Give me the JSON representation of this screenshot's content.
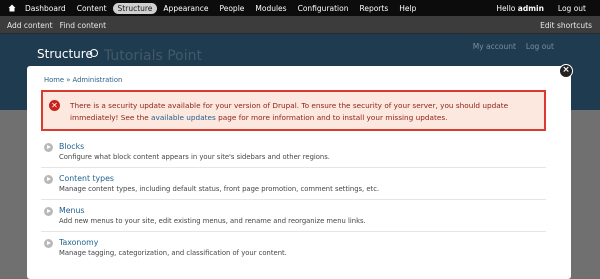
{
  "toolbar": {
    "items": [
      "Dashboard",
      "Content",
      "Structure",
      "Appearance",
      "People",
      "Modules",
      "Configuration",
      "Reports",
      "Help"
    ],
    "user_greeting": "Hello",
    "user_name": "admin",
    "logout": "Log out"
  },
  "shortcuts": {
    "links": [
      "Add content",
      "Find content"
    ],
    "edit": "Edit shortcuts"
  },
  "header": {
    "title": "Structure",
    "site_name": "Tutorials Point",
    "my_account": "My account",
    "logout": "Log out"
  },
  "overlay": {
    "breadcrumb": "Home » Administration",
    "alert": {
      "text_before": "There is a security update available for your version of Drupal. To ensure the security of your server, you should update immediately! See the",
      "link": "available updates",
      "text_after": "page for more information and to install your missing updates."
    },
    "items": [
      {
        "title": "Blocks",
        "description": "Configure what block content appears in your site's sidebars and other regions."
      },
      {
        "title": "Content types",
        "description": "Manage content types, including default status, front page promotion, comment settings, etc."
      },
      {
        "title": "Menus",
        "description": "Add new menus to your site, edit existing menus, and rename and reorganize menu links."
      },
      {
        "title": "Taxonomy",
        "description": "Manage tagging, categorization, and classification of your content."
      }
    ]
  },
  "colors": {
    "toolbar_bg": "#0c0c0c",
    "header_bg": "#1f3b4f",
    "alert_border": "#d93b30",
    "link": "#1f5f8f"
  }
}
